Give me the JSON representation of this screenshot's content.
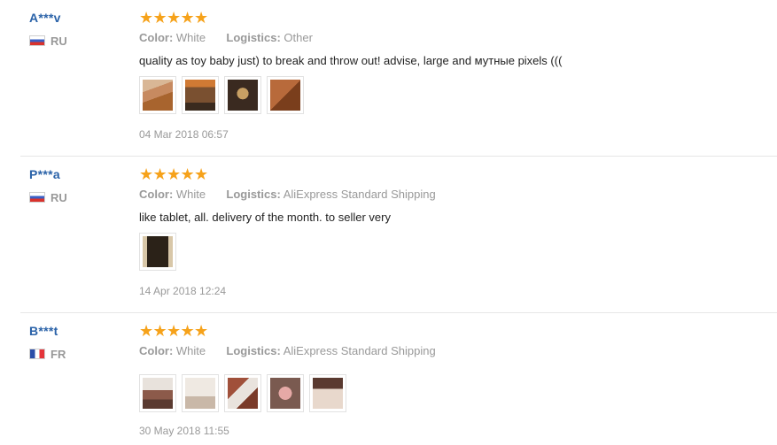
{
  "reviews": [
    {
      "user": "A***v",
      "country": "RU",
      "color_label": "Color:",
      "color_value": "White",
      "logistics_label": "Logistics:",
      "logistics_value": "Other",
      "text": "quality as toy baby just) to break and throw out! advise, large and мутные pixels (((",
      "date": "04 Mar 2018 06:57",
      "thumbs": [
        "#b86a3b",
        "#6b4a2a",
        "#7a5a30",
        "#8a4a24"
      ]
    },
    {
      "user": "P***a",
      "country": "RU",
      "color_label": "Color:",
      "color_value": "White",
      "logistics_label": "Logistics:",
      "logistics_value": "AliExpress Standard Shipping",
      "text": "like tablet, all. delivery of the month. to seller very",
      "date": "14 Apr 2018 12:24",
      "thumbs": [
        "#3a2f25"
      ]
    },
    {
      "user": "B***t",
      "country": "FR",
      "color_label": "Color:",
      "color_value": "White",
      "logistics_label": "Logistics:",
      "logistics_value": "AliExpress Standard Shipping",
      "text": "",
      "date": "30 May 2018 11:55",
      "thumbs": [
        "#8c5a4a",
        "#d9d0c8",
        "#a0503a",
        "#c98f86",
        "#b08070"
      ]
    }
  ],
  "rating": {
    "stars": 5,
    "star_color": "#f6a21a"
  },
  "colors": {
    "username": "#2a62a8",
    "muted": "#999999"
  }
}
